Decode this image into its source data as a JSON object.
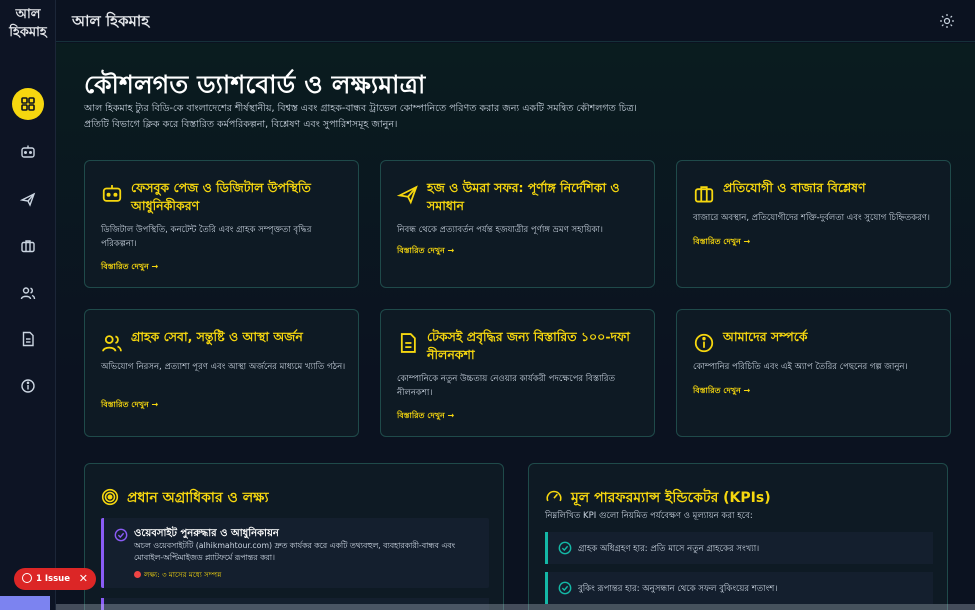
{
  "brand": {
    "line1": "আল",
    "line2": "হিকমাহ"
  },
  "topbar": {
    "title": "আল হিকমাহ",
    "theme_icon": "sun-icon"
  },
  "sidebar": {
    "items": [
      {
        "name": "dashboard",
        "icon": "grid-icon",
        "active": true
      },
      {
        "name": "facebook",
        "icon": "chat-bot-icon",
        "active": false
      },
      {
        "name": "hajj",
        "icon": "plane-icon",
        "active": false
      },
      {
        "name": "market",
        "icon": "briefcase-icon",
        "active": false
      },
      {
        "name": "customers",
        "icon": "users-icon",
        "active": false
      },
      {
        "name": "plan",
        "icon": "document-icon",
        "active": false
      },
      {
        "name": "about",
        "icon": "info-icon",
        "active": false
      }
    ]
  },
  "hero": {
    "title": "কৌশলগত ড্যাশবোর্ড ও লক্ষ্যমাত্রা",
    "description": "আল হিকমাহ ট্যুর বিডি-কে বাংলাদেশের শীর্ষস্থানীয়, বিশ্বস্ত এবং গ্রাহক-বান্ধব ট্রাভেল কোম্পানিতে পরিণত করার জন্য একটি সমন্বিত কৌশলগত চিত্র। প্রতিটি বিভাগে ক্লিক করে বিস্তারিত কর্মপরিকল্পনা, বিশ্লেষণ এবং সুপারিশসমূহ জানুন।"
  },
  "cards": [
    {
      "title": "ফেসবুক পেজ ও ডিজিটাল উপস্থিতি আধুনিকীকরণ",
      "desc": "ডিজিটাল উপস্থিতি, কনটেন্ট তৈরি এবং গ্রাহক সম্পৃক্ততা বৃদ্ধির পরিকল্পনা।",
      "link": "বিস্তারিত দেখুন →",
      "icon": "chat-bot-icon"
    },
    {
      "title": "হজ ও উমরা সফর: পূর্ণাঙ্গ নির্দেশিকা ও সমাধান",
      "desc": "নিবন্ধ থেকে প্রত্যাবর্তন পর্যন্ত হজযাত্রীর পূর্ণাঙ্গ ভ্রমণ সহায়িকা।",
      "link": "বিস্তারিত দেখুন →",
      "icon": "plane-icon"
    },
    {
      "title": "প্রতিযোগী ও বাজার বিশ্লেষণ",
      "desc": "বাজারে অবস্থান, প্রতিযোগীদের শক্তি-দুর্বলতা এবং সুযোগ চিহ্নিতকরণ।",
      "link": "বিস্তারিত দেখুন →",
      "icon": "briefcase-icon"
    },
    {
      "title": "গ্রাহক সেবা, সন্তুষ্টি ও আস্থা অর্জন",
      "desc": "অভিযোগ নিরসন, প্রত্যাশা পূরণ এবং আস্থা অর্জনের মাধ্যমে খ্যাতি গঠন।",
      "link": "বিস্তারিত দেখুন →",
      "icon": "users-icon"
    },
    {
      "title": "টেকসই প্রবৃদ্ধির জন্য বিস্তারিত ১০০-দফা নীলনকশা",
      "desc": "কোম্পানিকে নতুন উচ্চতায় নেওয়ার কার্যকরী পদক্ষেপের বিস্তারিত নীলনকশা।",
      "link": "বিস্তারিত দেখুন →",
      "icon": "document-icon"
    },
    {
      "title": "আমাদের সম্পর্কে",
      "desc": "কোম্পানির পরিচিতি এবং এই অ্যাপ তৈরির পেছনের গল্প জানুন।",
      "link": "বিস্তারিত দেখুন →",
      "icon": "info-icon"
    }
  ],
  "priorities": {
    "title": "প্রধান অগ্রাধিকার ও লক্ষ্য",
    "items": [
      {
        "title": "ওয়েবসাইট পুনরুদ্ধার ও আধুনিকায়ন",
        "desc": "অচল ওয়েবসাইটটি (alhikmahtour.com) দ্রুত কার্যকর করে একটি তথ্যবহুল, ব্যবহারকারী-বান্ধব এবং মোবাইল-অপ্টিমাইজড প্ল্যাটফর্মে রূপান্তর করা।",
        "meta": "লক্ষ্য: ৩ মাসের মধ্যে সম্পন্ন"
      }
    ]
  },
  "kpis": {
    "title": "মূল পারফরম্যান্স ইন্ডিকেটর (KPIs)",
    "subtitle": "নিম্নলিখিত KPI গুলো নিয়মিত পর্যবেক্ষণ ও মূল্যায়ন করা হবে:",
    "items": [
      {
        "text": "গ্রাহক অধিগ্রহণ হার: প্রতি মাসে নতুন গ্রাহকের সংখ্যা।"
      },
      {
        "text": "বুকিং রূপান্তর হার: অনুসন্ধান থেকে সফল বুকিংয়ের শতাংশ।"
      }
    ]
  },
  "issue": {
    "label": "1 Issue",
    "close": "✕"
  },
  "colors": {
    "accent": "#f6d70f",
    "teal": "#14b8a6",
    "purple": "#8b5cf6",
    "background": "#0b1220"
  }
}
